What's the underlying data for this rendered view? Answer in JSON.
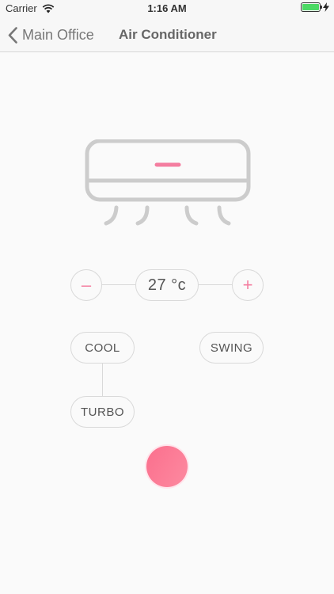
{
  "status_bar": {
    "carrier": "Carrier",
    "time": "1:16 AM",
    "battery_level": 1.0,
    "icons": [
      "wifi-icon",
      "battery-icon",
      "charging-icon"
    ]
  },
  "nav": {
    "back_label": "Main Office",
    "title": "Air Conditioner"
  },
  "controls": {
    "decrease_symbol": "–",
    "increase_symbol": "+",
    "temperature": "27 °c",
    "modes": {
      "cool": "COOL",
      "swing": "SWING",
      "turbo": "TURBO"
    }
  },
  "colors": {
    "accent": "#f47ea0",
    "power_gradient_start": "#fb6f8d",
    "power_gradient_end": "#fc8aa0",
    "outline": "#d9d9d9",
    "icon_gray": "#cccccc"
  }
}
